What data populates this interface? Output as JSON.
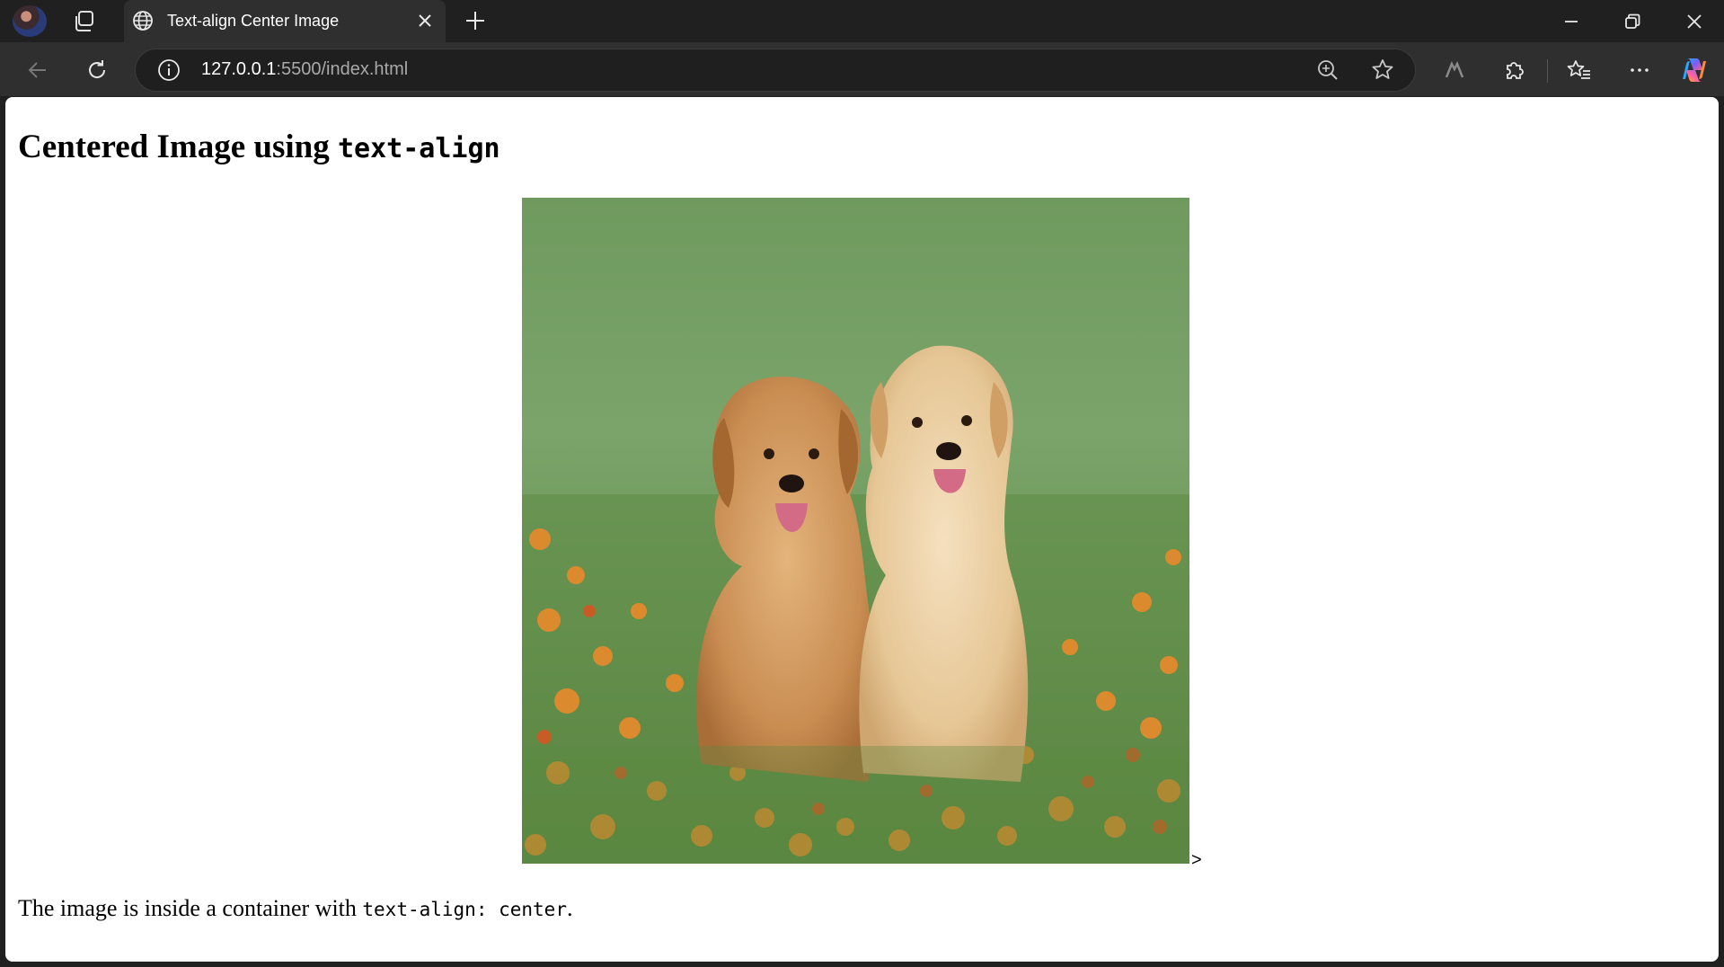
{
  "browser": {
    "tab": {
      "title": "Text-align Center Image",
      "favicon": "globe-icon"
    },
    "url": {
      "host": "127.0.0.1",
      "rest": ":5500/index.html"
    },
    "icons": [
      "profile-avatar",
      "workspaces-icon",
      "close-icon",
      "plus-icon",
      "minimize-icon",
      "restore-icon",
      "back-icon",
      "refresh-icon",
      "info-icon",
      "zoom-icon",
      "star-icon",
      "read-aloud-icon",
      "extensions-icon",
      "favorites-icon",
      "more-icon",
      "copilot-icon"
    ]
  },
  "page": {
    "heading_text": "Centered Image using ",
    "heading_code": "text-align",
    "image_alt": "Two golden retriever puppies sitting in grass with orange flowers",
    "broken_mark": ">",
    "caption_text": "The image is inside a container with ",
    "caption_code": "text-align: center",
    "caption_end": "."
  }
}
